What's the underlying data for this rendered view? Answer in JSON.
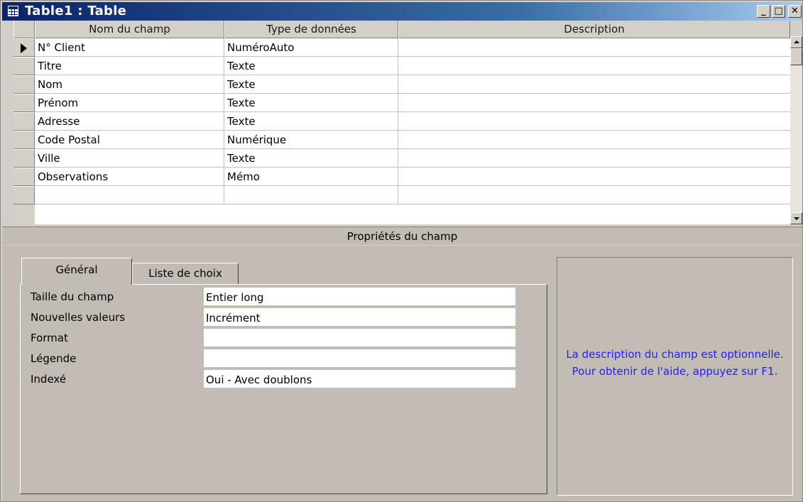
{
  "window": {
    "title": "Table1 : Table",
    "buttons": {
      "minimize": "_",
      "maximize": "□",
      "close": "✕"
    }
  },
  "grid": {
    "headers": [
      "Nom du champ",
      "Type de données",
      "Description"
    ],
    "rows": [
      {
        "name": "N° Client",
        "type": "NuméroAuto",
        "description": ""
      },
      {
        "name": "Titre",
        "type": "Texte",
        "description": ""
      },
      {
        "name": "Nom",
        "type": "Texte",
        "description": ""
      },
      {
        "name": "Prénom",
        "type": "Texte",
        "description": ""
      },
      {
        "name": "Adresse",
        "type": "Texte",
        "description": ""
      },
      {
        "name": "Code Postal",
        "type": "Numérique",
        "description": ""
      },
      {
        "name": "Ville",
        "type": "Texte",
        "description": ""
      },
      {
        "name": "Observations",
        "type": "Mémo",
        "description": ""
      },
      {
        "name": "",
        "type": "",
        "description": ""
      }
    ],
    "current_row": 0
  },
  "properties": {
    "title": "Propriétés du champ",
    "tabs": [
      "Général",
      "Liste de choix"
    ],
    "active_tab": "Général",
    "fields": [
      {
        "label": "Taille du champ",
        "value": "Entier long"
      },
      {
        "label": "Nouvelles valeurs",
        "value": "Incrément"
      },
      {
        "label": "Format",
        "value": ""
      },
      {
        "label": "Légende",
        "value": ""
      },
      {
        "label": "Indexé",
        "value": "Oui - Avec doublons"
      }
    ],
    "help_text": "La description du champ est optionnelle. Pour obtenir de l'aide, appuyez sur F1."
  },
  "colors": {
    "help_text": "#2020ff",
    "title_bar": "#0a246a"
  }
}
